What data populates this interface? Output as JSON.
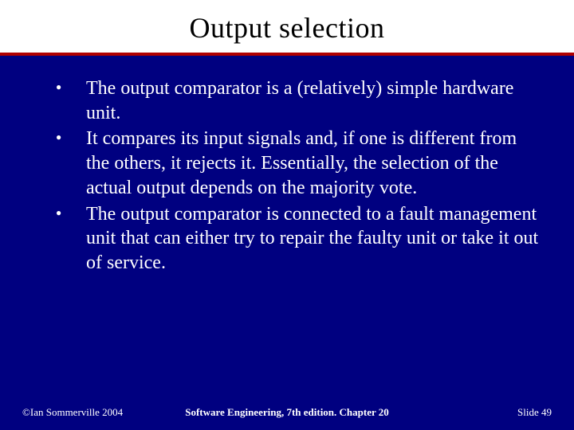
{
  "title": "Output selection",
  "bullets": [
    "The output comparator is a (relatively) simple hardware unit.",
    "It compares its input signals and, if one is different from the others, it rejects it. Essentially, the selection of the actual output depends on the majority vote.",
    "The output comparator is connected to a fault management unit that can either try to repair the faulty unit or take it out of service."
  ],
  "footer": {
    "left": "©Ian Sommerville 2004",
    "center": "Software Engineering, 7th edition. Chapter 20",
    "right": "Slide 49"
  },
  "colors": {
    "background": "#000080",
    "rule": "#b00000",
    "title_bg": "#ffffff"
  }
}
